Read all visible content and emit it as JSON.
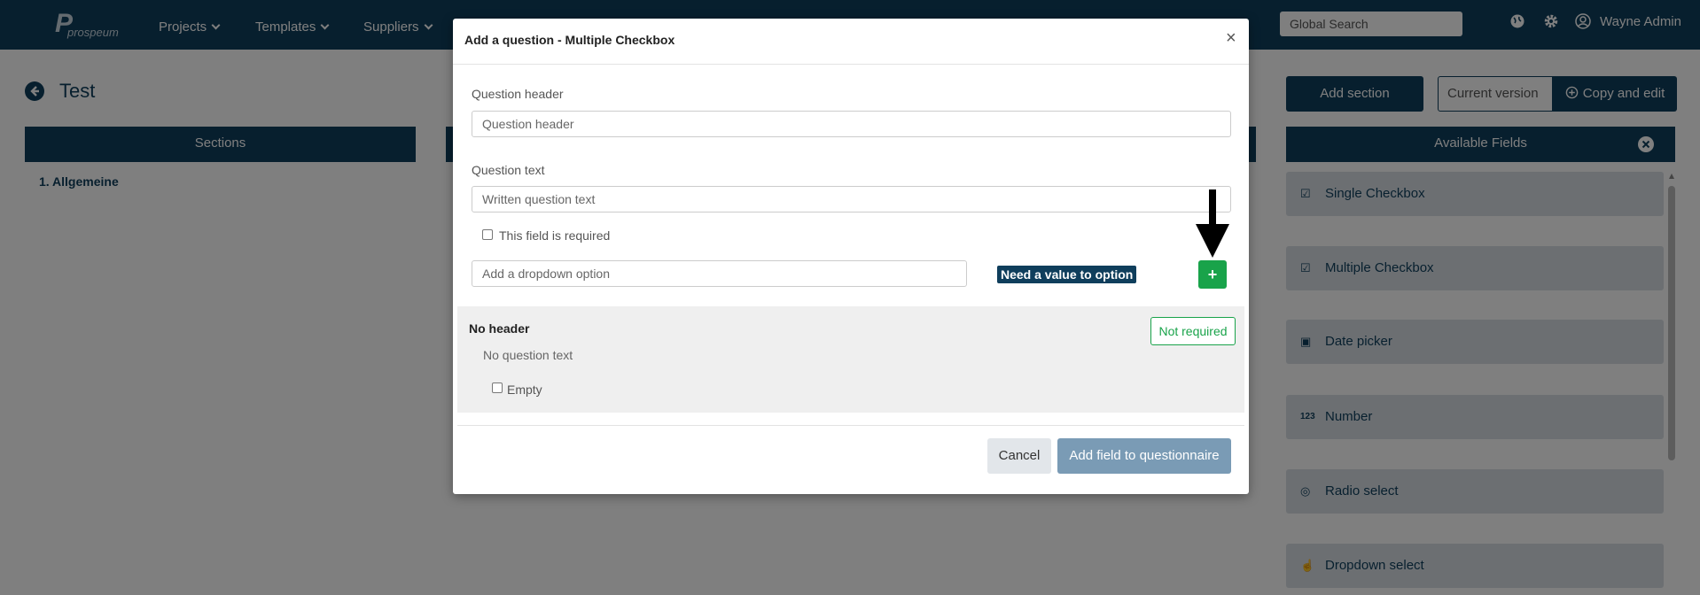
{
  "navbar": {
    "logo_text": "prospeum",
    "logo_mark": "P",
    "items": [
      {
        "label": "Projects"
      },
      {
        "label": "Templates"
      },
      {
        "label": "Suppliers"
      }
    ],
    "search_placeholder": "Global Search",
    "icons": [
      "globe-icon",
      "gear-icon",
      "user-circle-icon"
    ],
    "user_name": "Wayne Admin"
  },
  "page": {
    "title": "Test",
    "sections_header": "Sections",
    "sections": [
      "1. Allgemeine"
    ],
    "add_section_label": "Add section",
    "version_select": "Current version",
    "copy_edit_label": "Copy and edit",
    "available_fields_header": "Available Fields",
    "available_fields": [
      {
        "label": "Single Checkbox",
        "icon": "checkbox-icon"
      },
      {
        "label": "Multiple Checkbox",
        "icon": "multi-checkbox-icon"
      },
      {
        "label": "Date picker",
        "icon": "calendar-icon"
      },
      {
        "label": "Number",
        "icon": "number-icon",
        "glyph": "123"
      },
      {
        "label": "Radio select",
        "icon": "radio-check-icon"
      },
      {
        "label": "Dropdown select",
        "icon": "pointer-icon"
      }
    ]
  },
  "modal": {
    "title": "Add a question - Multiple Checkbox",
    "close_glyph": "×",
    "question_header_label": "Question header",
    "question_header_placeholder": "Question header",
    "question_text_label": "Question text",
    "question_text_placeholder": "Written question text",
    "required_label": "This field is required",
    "required_checked": false,
    "dropdown_option_placeholder": "Add a dropdown option",
    "value_hint": "Need a value to option",
    "add_option_glyph": "+",
    "preview": {
      "header": "No header",
      "text": "No question text",
      "option": "Empty",
      "status": "Not required"
    },
    "cancel_label": "Cancel",
    "submit_label": "Add field to questionnaire"
  },
  "colors": {
    "primary": "#0f3e5c",
    "success": "#19a34a",
    "submit_disabled": "#7a9bb5",
    "field_card": "#d8dfe5"
  }
}
